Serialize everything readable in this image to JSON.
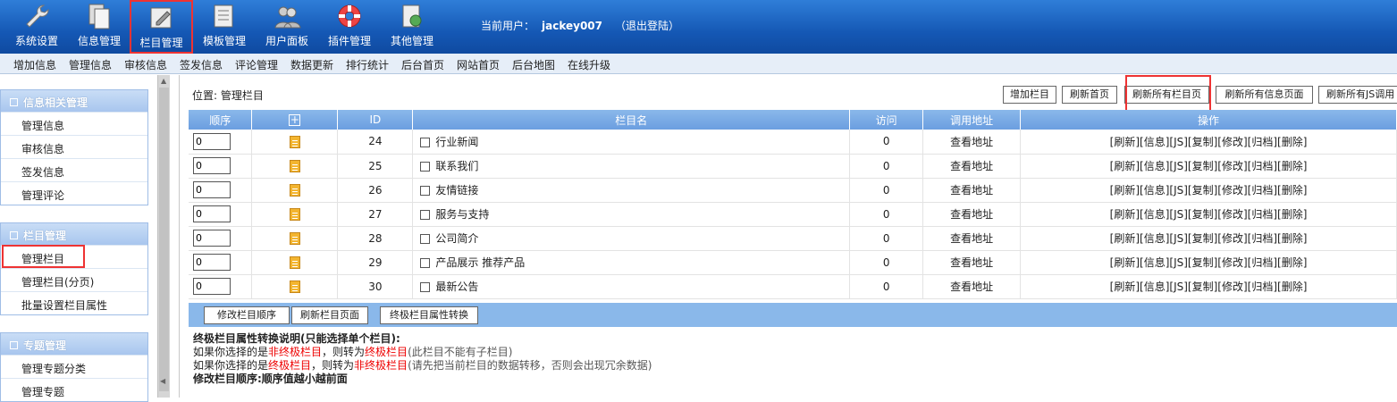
{
  "top_nav": [
    {
      "label": "系统设置",
      "icon": "wrench-icon"
    },
    {
      "label": "信息管理",
      "icon": "documents-icon"
    },
    {
      "label": "栏目管理",
      "icon": "folder-edit-icon"
    },
    {
      "label": "模板管理",
      "icon": "template-icon"
    },
    {
      "label": "用户面板",
      "icon": "users-icon"
    },
    {
      "label": "插件管理",
      "icon": "lifebuoy-icon"
    },
    {
      "label": "其他管理",
      "icon": "settings-doc-icon"
    }
  ],
  "user": {
    "label": "当前用户：",
    "name": "jackey007",
    "logout": "（退出登陆）"
  },
  "sub_nav": [
    "增加信息",
    "管理信息",
    "审核信息",
    "签发信息",
    "评论管理",
    "数据更新",
    "排行统计",
    "后台首页",
    "网站首页",
    "后台地图",
    "在线升级"
  ],
  "sidebar": [
    {
      "title": "信息相关管理",
      "items": [
        "管理信息",
        "审核信息",
        "签发信息",
        "管理评论"
      ]
    },
    {
      "title": "栏目管理",
      "items": [
        "管理栏目",
        "管理栏目(分页)",
        "批量设置栏目属性"
      ]
    },
    {
      "title": "专题管理",
      "items": [
        "管理专题分类",
        "管理专题"
      ]
    }
  ],
  "location": "位置: 管理栏目",
  "toolbar": [
    "增加栏目",
    "刷新首页",
    "刷新所有栏目页",
    "刷新所有信息页面",
    "刷新所有JS调用"
  ],
  "table": {
    "headers": [
      "顺序",
      "",
      "ID",
      "栏目名",
      "访问",
      "调用地址",
      "操作"
    ],
    "rows": [
      {
        "order": "0",
        "id": "24",
        "name": "行业新闻",
        "visits": "0",
        "addr": "查看地址"
      },
      {
        "order": "0",
        "id": "25",
        "name": "联系我们",
        "visits": "0",
        "addr": "查看地址"
      },
      {
        "order": "0",
        "id": "26",
        "name": "友情链接",
        "visits": "0",
        "addr": "查看地址"
      },
      {
        "order": "0",
        "id": "27",
        "name": "服务与支持",
        "visits": "0",
        "addr": "查看地址"
      },
      {
        "order": "0",
        "id": "28",
        "name": "公司简介",
        "visits": "0",
        "addr": "查看地址"
      },
      {
        "order": "0",
        "id": "29",
        "name": "产品展示 推荐产品",
        "visits": "0",
        "addr": "查看地址"
      },
      {
        "order": "0",
        "id": "30",
        "name": "最新公告",
        "visits": "0",
        "addr": "查看地址"
      }
    ],
    "ops": [
      "[刷新]",
      "[信息]",
      "[JS]",
      "[复制]",
      "[修改]",
      "[归档]",
      "[删除]"
    ]
  },
  "bottom_buttons": [
    "修改栏目顺序",
    "刷新栏目页面",
    "终极栏目属性转换"
  ],
  "notes": {
    "title": "终极栏目属性转换说明(只能选择单个栏目):",
    "l1": [
      "如果你选择的是",
      "非终极栏目",
      "，则转为",
      "终极栏目",
      "(此栏目不能有子栏目)"
    ],
    "l2": [
      "如果你选择的是",
      "终极栏目",
      "，则转为",
      "非终极栏目",
      "(请先把当前栏目的数据转移，否则会出现冗余数据)"
    ],
    "l3": "修改栏目顺序:顺序值越小越前面"
  }
}
